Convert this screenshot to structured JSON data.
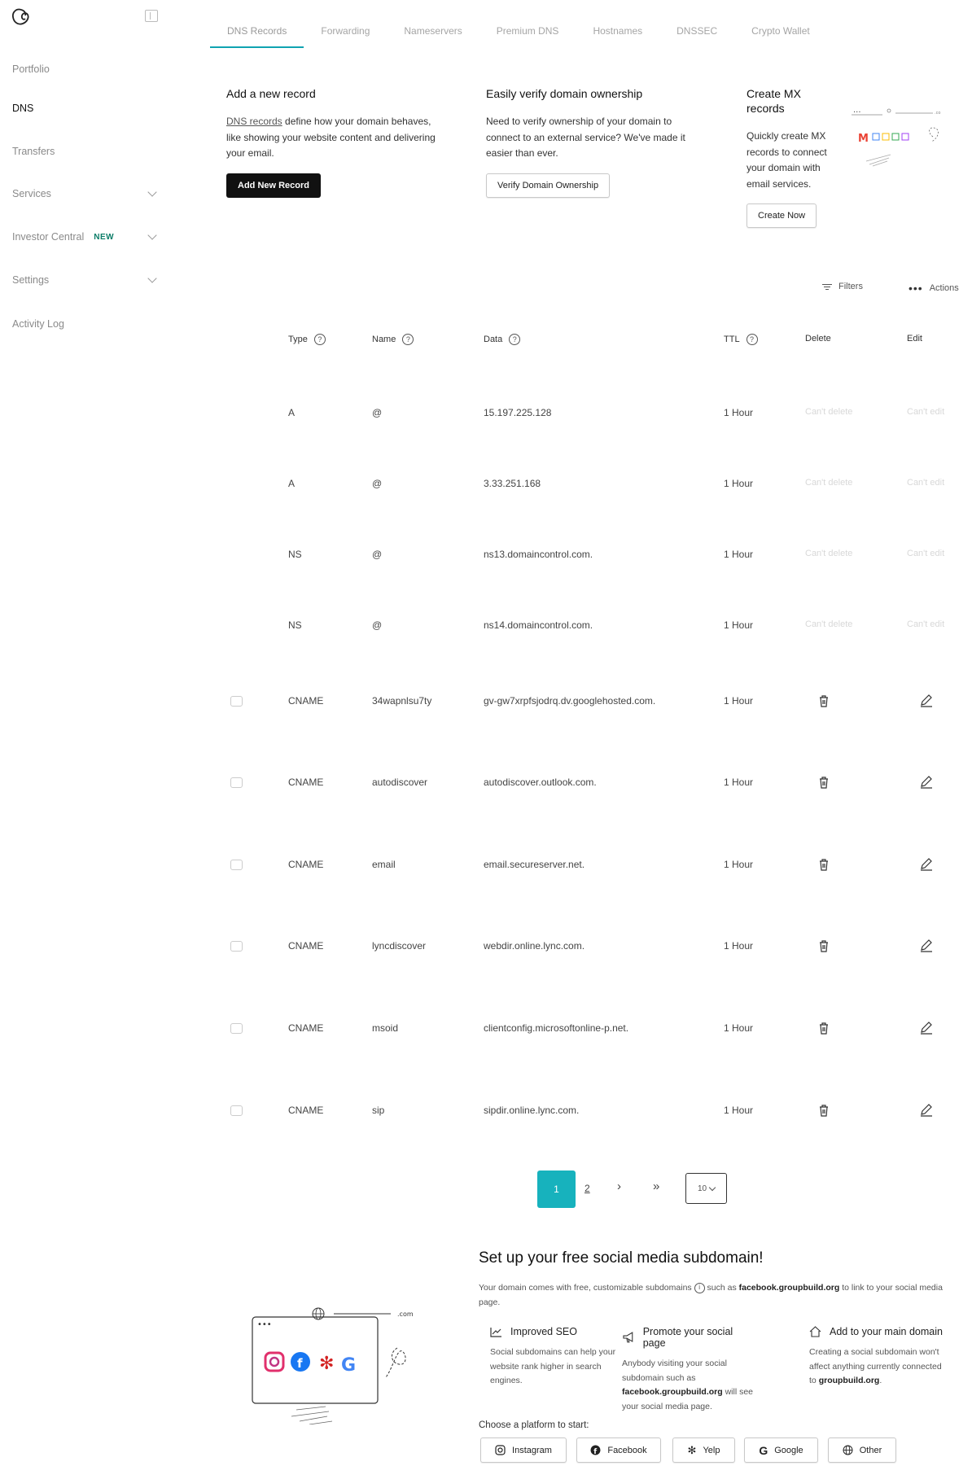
{
  "sidebar": {
    "items": [
      {
        "label": "Portfolio",
        "active": false
      },
      {
        "label": "DNS",
        "active": true
      },
      {
        "label": "Transfers",
        "active": false
      },
      {
        "label": "Services",
        "active": false,
        "expandable": true
      },
      {
        "label": "Investor Central",
        "active": false,
        "expandable": true,
        "badge": "NEW"
      },
      {
        "label": "Settings",
        "active": false,
        "expandable": true
      },
      {
        "label": "Activity Log",
        "active": false
      }
    ]
  },
  "tabs": [
    "DNS Records",
    "Forwarding",
    "Nameservers",
    "Premium DNS",
    "Hostnames",
    "DNSSEC",
    "Crypto Wallet"
  ],
  "cards": {
    "add_record": {
      "title": "Add a new record",
      "link_text": "DNS records",
      "description": " define how your domain behaves, like showing your website content and delivering your email.",
      "button": "Add New Record"
    },
    "verify": {
      "title": "Easily verify domain ownership",
      "description": "Need to verify ownership of your domain to connect to an external service? We've made it easier than ever.",
      "button": "Verify Domain Ownership"
    },
    "mx": {
      "title": "Create MX records",
      "description": "Quickly create MX records to connect your domain with email services.",
      "button": "Create Now"
    }
  },
  "toolbar": {
    "filters": "Filters",
    "actions": "Actions"
  },
  "table": {
    "headers": {
      "type": "Type",
      "name": "Name",
      "data": "Data",
      "ttl": "TTL",
      "delete": "Delete",
      "edit": "Edit"
    },
    "locked_delete": "Can't delete",
    "locked_edit": "Can't edit",
    "rows": [
      {
        "type": "A",
        "name": "@",
        "data": "15.197.225.128",
        "ttl": "1 Hour",
        "locked": true
      },
      {
        "type": "A",
        "name": "@",
        "data": "3.33.251.168",
        "ttl": "1 Hour",
        "locked": true
      },
      {
        "type": "NS",
        "name": "@",
        "data": "ns13.domaincontrol.com.",
        "ttl": "1 Hour",
        "locked": true
      },
      {
        "type": "NS",
        "name": "@",
        "data": "ns14.domaincontrol.com.",
        "ttl": "1 Hour",
        "locked": true
      },
      {
        "type": "CNAME",
        "name": "34wapnlsu7ty",
        "data": "gv-gw7xrpfsjodrq.dv.googlehosted.com.",
        "ttl": "1 Hour",
        "locked": false
      },
      {
        "type": "CNAME",
        "name": "autodiscover",
        "data": "autodiscover.outlook.com.",
        "ttl": "1 Hour",
        "locked": false
      },
      {
        "type": "CNAME",
        "name": "email",
        "data": "email.secureserver.net.",
        "ttl": "1 Hour",
        "locked": false
      },
      {
        "type": "CNAME",
        "name": "lyncdiscover",
        "data": "webdir.online.lync.com.",
        "ttl": "1 Hour",
        "locked": false
      },
      {
        "type": "CNAME",
        "name": "msoid",
        "data": "clientconfig.microsoftonline-p.net.",
        "ttl": "1 Hour",
        "locked": false
      },
      {
        "type": "CNAME",
        "name": "sip",
        "data": "sipdir.online.lync.com.",
        "ttl": "1 Hour",
        "locked": false
      }
    ]
  },
  "pagination": {
    "current": "1",
    "next_page": "2",
    "next": "›",
    "last": "»",
    "page_size": "10"
  },
  "social": {
    "title": "Set up your free social media subdomain!",
    "desc_part1": "Your domain comes with free, customizable subdomains",
    "desc_part2": " such as ",
    "desc_example": "facebook.groupbuild.org",
    "desc_part3": " to link to your social media page.",
    "features": [
      {
        "title": "Improved SEO",
        "text": "Social subdomains can help your website rank higher in search engines."
      },
      {
        "title": "Promote your social page",
        "text_before": "Anybody visiting your social subdomain such as ",
        "text_bold": "facebook.groupbuild.org",
        "text_after": " will see your social media page."
      },
      {
        "title": "Add to your main domain",
        "text_before": "Creating a social subdomain won't affect anything currently connected to ",
        "text_bold": "groupbuild.org",
        "text_after": "."
      }
    ],
    "choose_label": "Choose a platform to start:",
    "platforms": [
      "Instagram",
      "Facebook",
      "Yelp",
      "Google",
      "Other"
    ],
    "illus_tld": ".com"
  },
  "colors": {
    "accent": "#17b2bd",
    "tab_underline": "#0fa3b1",
    "badge": "#0a7c67",
    "dark_button": "#111111"
  }
}
